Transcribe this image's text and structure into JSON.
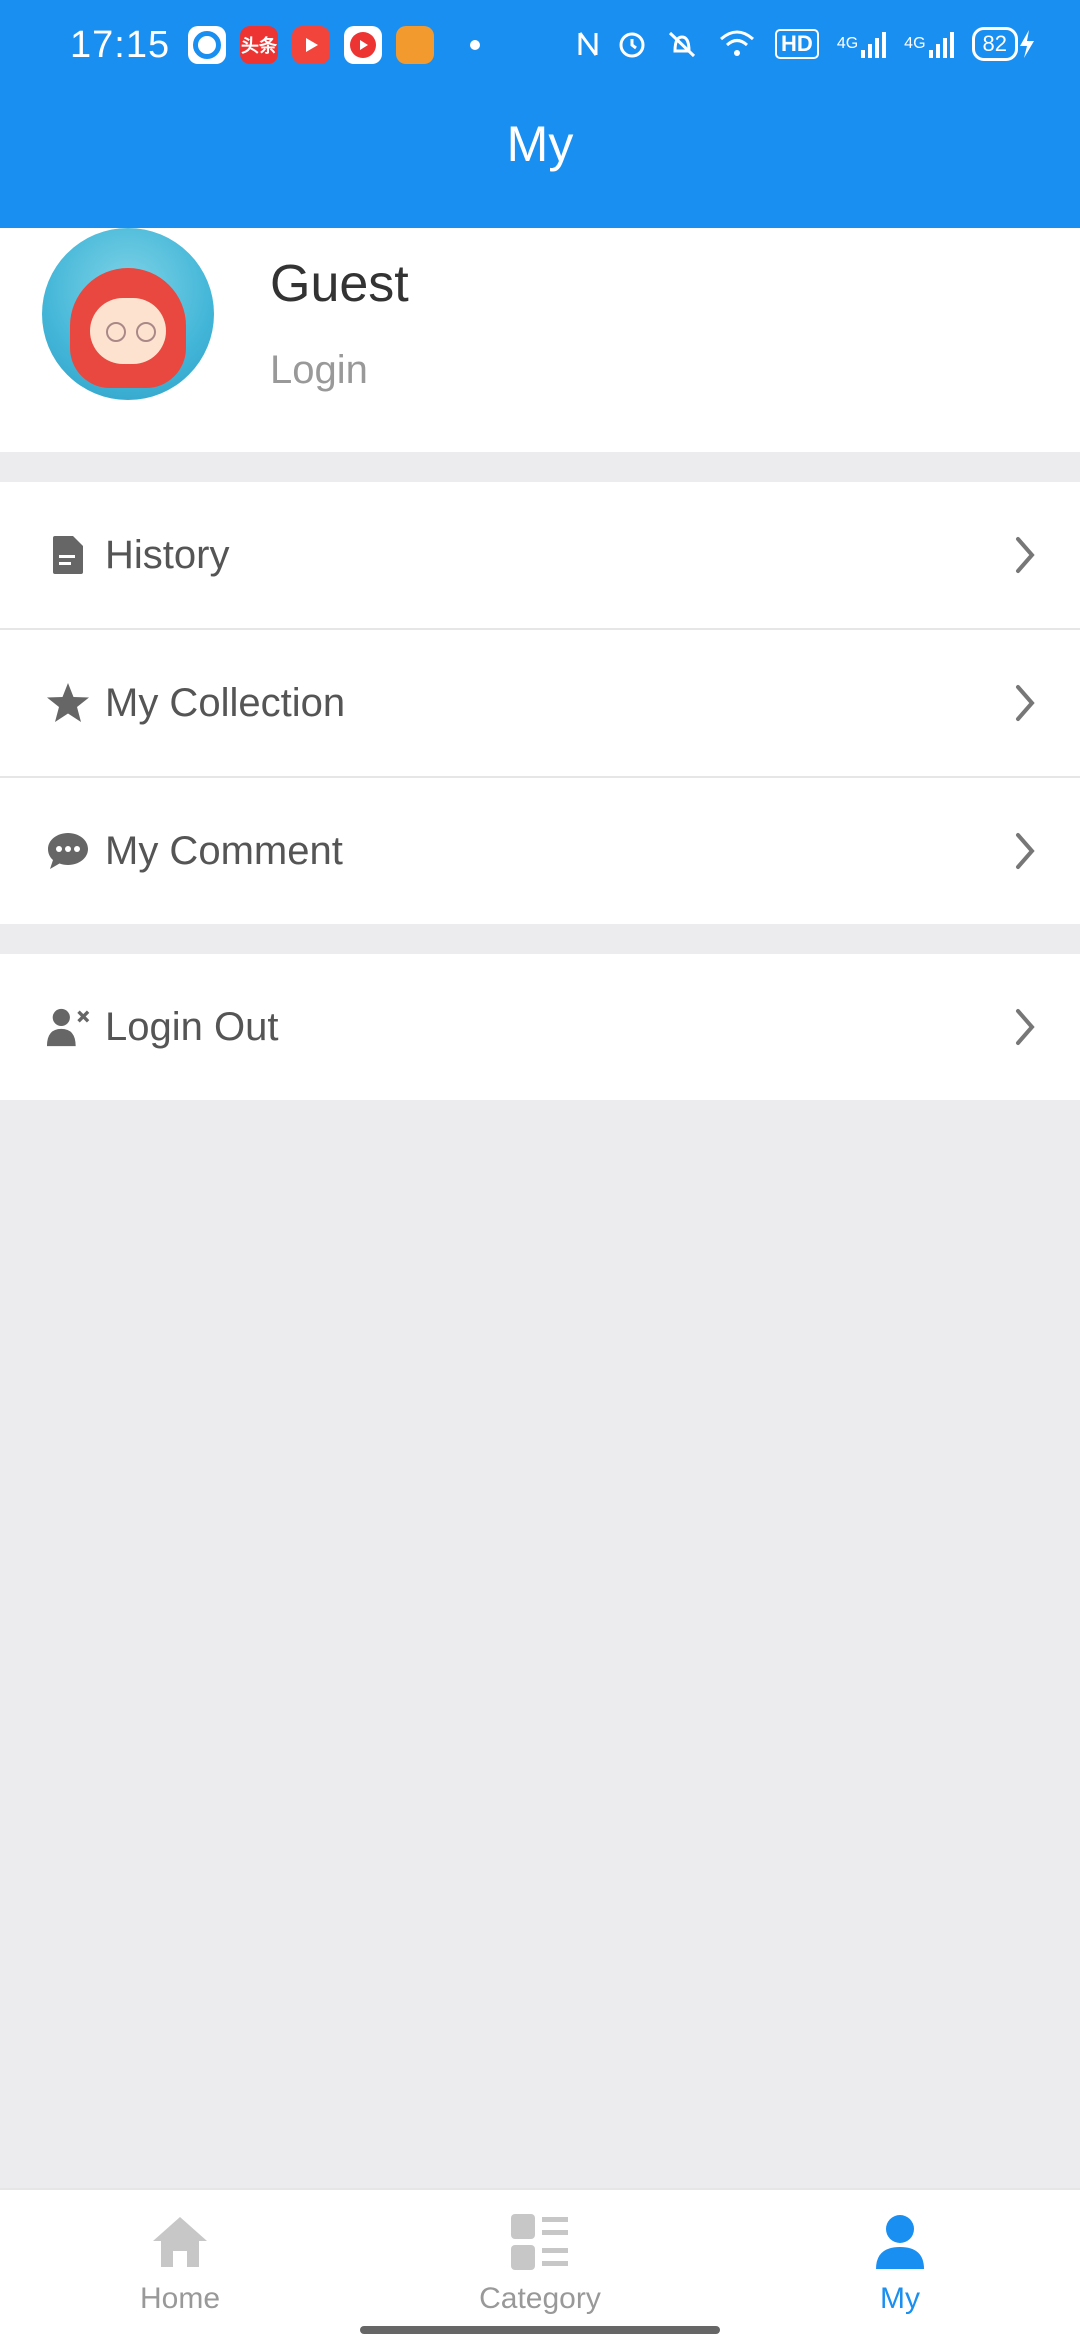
{
  "status": {
    "time": "17:15",
    "app_icons": [
      "头条"
    ],
    "network_1": "4G",
    "network_2": "4G",
    "hd": "HD",
    "battery": "82"
  },
  "header": {
    "title": "My"
  },
  "profile": {
    "name": "Guest",
    "login_label": "Login"
  },
  "menu": [
    {
      "label": "History",
      "icon": "document-icon"
    },
    {
      "label": "My Collection",
      "icon": "star-icon"
    },
    {
      "label": "My Comment",
      "icon": "comment-icon"
    }
  ],
  "menu2": [
    {
      "label": "Login Out",
      "icon": "user-remove-icon"
    }
  ],
  "tabs": [
    {
      "label": "Home",
      "icon": "home-icon",
      "active": false
    },
    {
      "label": "Category",
      "icon": "category-icon",
      "active": false
    },
    {
      "label": "My",
      "icon": "person-icon",
      "active": true
    }
  ],
  "colors": {
    "primary": "#1a8ff2",
    "background": "#ececee",
    "icon_gray": "#666666"
  }
}
